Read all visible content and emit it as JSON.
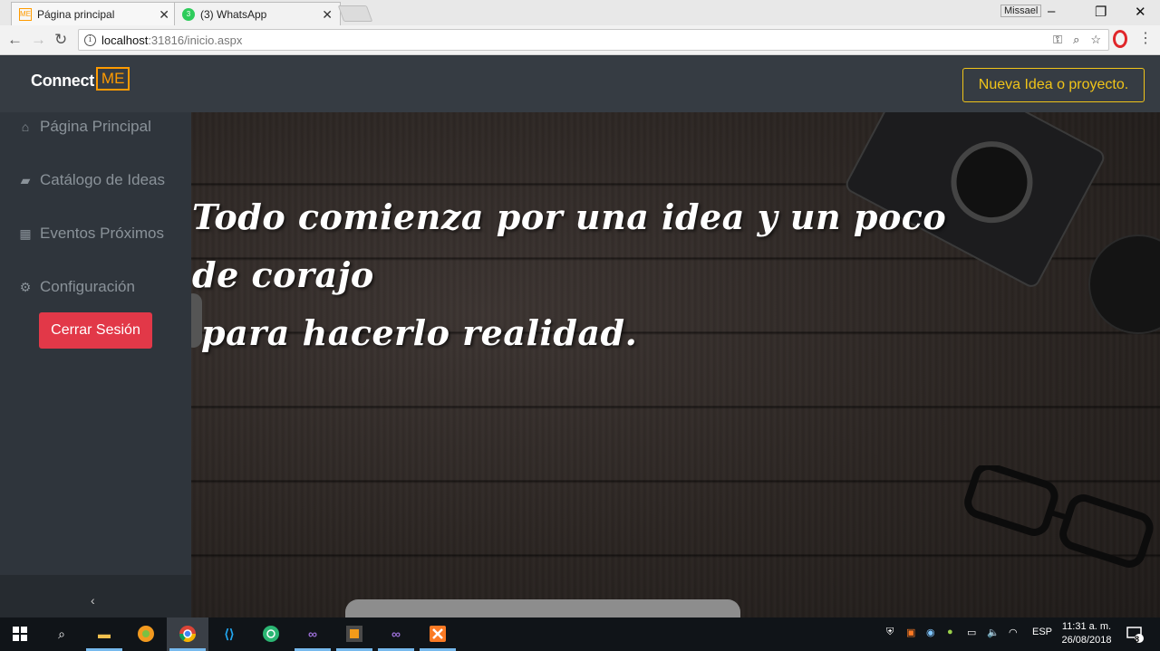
{
  "browser": {
    "tabs": [
      {
        "title": "Página principal",
        "active": true,
        "favicon": "connectme-icon"
      },
      {
        "title": "(3) WhatsApp",
        "active": false,
        "favicon": "whatsapp-icon"
      }
    ],
    "profile_name": "Missael",
    "url_host": "localhost",
    "url_rest": ":31816/inicio.aspx"
  },
  "app": {
    "logo_text": "Connect",
    "logo_highlight": "ME",
    "new_idea_label": "Nueva Idea o proyecto.",
    "accent_color": "#f0c419",
    "brand_color": "#ff9b00"
  },
  "sidebar": {
    "items": [
      {
        "label": "Página Principal",
        "icon": "home-icon"
      },
      {
        "label": "Catálogo de Ideas",
        "icon": "book-icon"
      },
      {
        "label": "Eventos Próximos",
        "icon": "calendar-grid-icon"
      },
      {
        "label": "Configuración",
        "icon": "gear-icon"
      }
    ],
    "logout_label": "Cerrar Sesión",
    "logout_color": "#e23848",
    "collapse_glyph": "‹"
  },
  "hero": {
    "line1": "Todo comienza por una idea y un poco de corajo",
    "line2": "para hacerlo realidad."
  },
  "taskbar": {
    "language": "ESP",
    "time": "11:31 a. m.",
    "date": "26/08/2018",
    "notifications": "8"
  }
}
